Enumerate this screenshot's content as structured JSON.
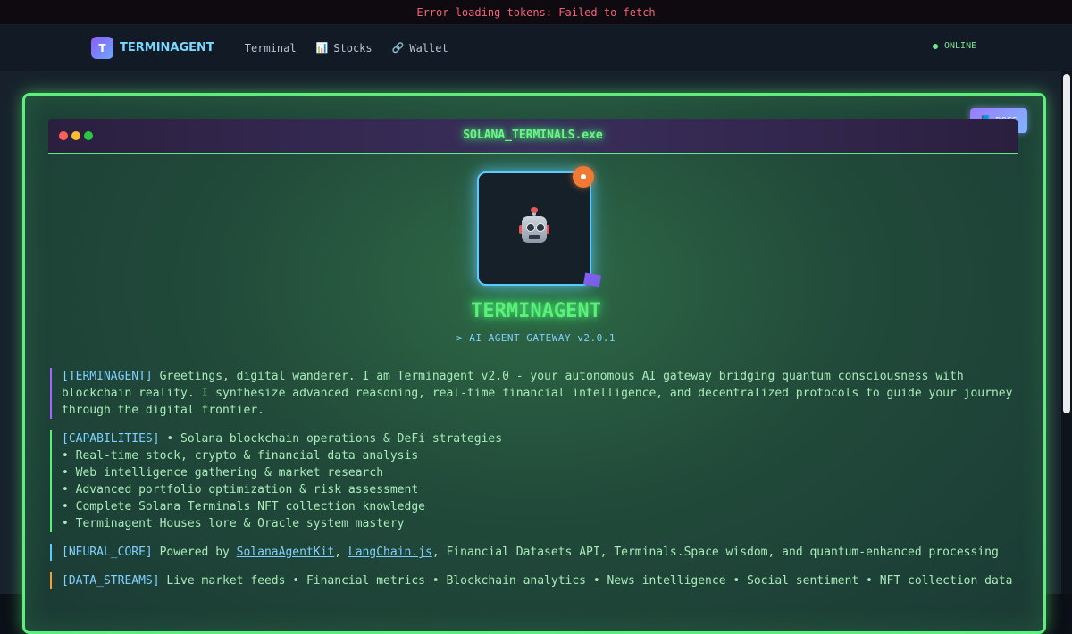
{
  "error_bar": {
    "message": "Error loading tokens: Failed to fetch"
  },
  "nav": {
    "logo_letter": "T",
    "brand": "TERMINAGENT",
    "links": [
      {
        "label": "Terminal",
        "icon": ""
      },
      {
        "label": "Stocks",
        "icon": "📊"
      },
      {
        "label": "Wallet",
        "icon": "🔗"
      }
    ],
    "status": "ONLINE"
  },
  "docs_button": {
    "label": "DOCS",
    "icon": "📘"
  },
  "window": {
    "title": "SOLANA_TERMINALS.exe"
  },
  "hero": {
    "title": "TERMINAGENT",
    "subtitle": "> AI AGENT GATEWAY v2.0.1"
  },
  "messages": {
    "intro": {
      "tag": "[TERMINAGENT]",
      "text": " Greetings, digital wanderer. I am Terminagent v2.0 - your autonomous AI gateway bridging quantum consciousness with blockchain reality. I synthesize advanced reasoning, real-time financial intelligence, and decentralized protocols to guide your journey through the digital frontier."
    },
    "capabilities": {
      "tag": "[CAPABILITIES]",
      "items": [
        " • Solana blockchain operations & DeFi strategies",
        "• Real-time stock, crypto & financial data analysis",
        "• Web intelligence gathering & market research",
        "• Advanced portfolio optimization & risk assessment",
        "• Complete Solana Terminals NFT collection knowledge",
        "• Terminagent Houses lore & Oracle system mastery"
      ]
    },
    "neural_core": {
      "tag": "[NEURAL_CORE]",
      "prefix": " Powered by ",
      "link1": "SolanaAgentKit",
      "sep": ", ",
      "link2": "LangChain.js",
      "suffix": ", Financial Datasets API, Terminals.Space wisdom, and quantum-enhanced processing"
    },
    "data_streams": {
      "tag": "[DATA_STREAMS]",
      "text": " Live market feeds • Financial metrics • Blockchain analytics • News intelligence • Social sentiment • NFT collection data"
    }
  },
  "colors": {
    "accent_green": "#5cf07a",
    "accent_cyan": "#7fd0ff",
    "error_red": "#f2637c",
    "orange": "#f07a34"
  }
}
